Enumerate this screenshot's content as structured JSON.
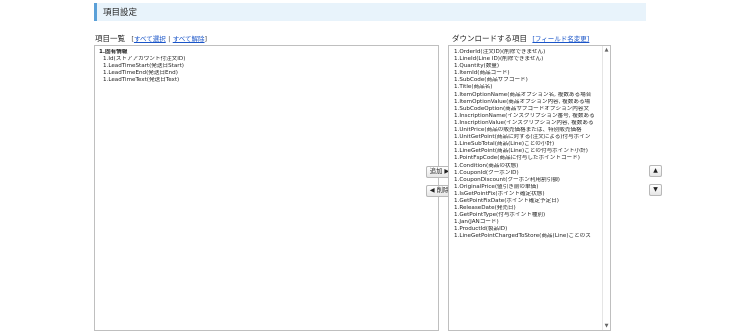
{
  "section": {
    "title": "項目設定"
  },
  "left": {
    "heading": "項目一覧",
    "bracket_open": "[",
    "select_all": "すべて選択",
    "separator": "|",
    "deselect_all": "すべて解除",
    "bracket_close": "]",
    "group_label": "1.固有情報",
    "items": [
      "1.Id(ストアアカウント付注文ID)",
      "1.LeadTimeStart(発送日Start)",
      "1.LeadTimeEnd(発送日End)",
      "1.LeadTimeText(発送日Text)"
    ]
  },
  "right": {
    "heading": "ダウンロードする項目",
    "field_name_change": "[フィールド名変更]",
    "items": [
      "1.OrderId(注文ID)(削除できません)",
      "1.LineId(Line ID)(削除できません)",
      "1.Quantity(数量)",
      "1.ItemId(商品コード)",
      "1.SubCode(商品サブコード)",
      "1.Title(商品名)",
      "1.ItemOptionName(商品オプション名, 複数ある場合",
      "1.ItemOptionValue(商品オプション内容, 複数ある場",
      "1.SubCodeOption(商品サブコードオプション内容文",
      "1.InscriptionName(インスクリプション番号, 複数ある",
      "1.InscriptionValue(インスクリプション内容, 複数ある",
      "1.UnitPrice(商品の販売価格または、特別販売価格",
      "1.UnitGetPoint(商品に対する(注文による)付与ポイン",
      "1.LineSubTotal(商品(Line)ごとの小計)",
      "1.LineGetPoint(商品(Line)ごとの付与ポイント小計)",
      "1.PointFspCode(商品に付与したポイントコード)",
      "1.Condition(商品の状態)",
      "1.CouponId(クーポンID)",
      "1.CouponDiscount(クーポン利用割引額)",
      "1.OriginalPrice(値引き前の単価)",
      "1.IsGetPointFix(ポイント確定状態)",
      "1.GetPointFixDate(ポイント確定予定日)",
      "1.ReleaseDate(発売日)",
      "1.GetPointType(付与ポイント種別)",
      "1.Jan(JANコード)",
      "1.ProductId(製品ID)",
      "1.LineGetPointChargedToStore(商品(Line)ごとのス"
    ]
  },
  "buttons": {
    "add": "追加 ▶",
    "remove": "◀ 削除",
    "up": "▲",
    "down": "▼"
  },
  "scrollbar": {
    "up": "▲",
    "down": "▼"
  }
}
